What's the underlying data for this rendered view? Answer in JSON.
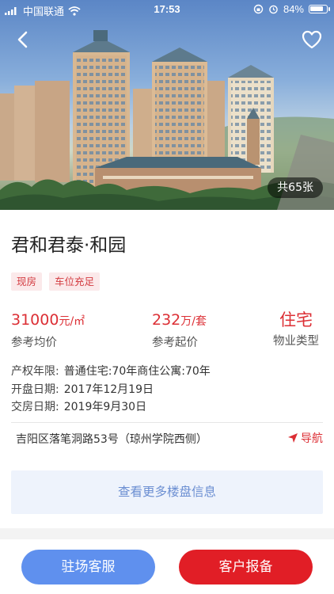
{
  "status_bar": {
    "carrier": "中国联通",
    "time": "17:53",
    "battery_text": "84%",
    "battery_level": 0.84
  },
  "hero": {
    "photo_count": "共65张"
  },
  "project": {
    "name": "君和君泰·和园",
    "tags": [
      "现房",
      "车位充足"
    ]
  },
  "stats": {
    "avg_price_value": "31000",
    "avg_price_unit": "元/㎡",
    "avg_price_label": "参考均价",
    "start_price_value": "232",
    "start_price_unit": "万/套",
    "start_price_label": "参考起价",
    "property_type_value": "住宅",
    "property_type_label": "物业类型"
  },
  "info": {
    "tenure_label": "产权年限:",
    "tenure_value": "普通住宅:70年商住公寓:70年",
    "opening_label": "开盘日期:",
    "opening_value": "2017年12月19日",
    "delivery_label": "交房日期:",
    "delivery_value": "2019年9月30日"
  },
  "address": {
    "text": "吉阳区落笔洞路53号（琼州学院西侧）",
    "nav_label": "导航"
  },
  "more_info_label": "查看更多楼盘信息",
  "bottom_bar": {
    "service_label": "驻场客服",
    "report_label": "客户报备"
  },
  "colors": {
    "accent_red": "#dc2f35",
    "tag_bg": "#fbe9ea",
    "service_blue": "#5f90ee",
    "report_red": "#e11e26",
    "more_bg": "#eef3fc",
    "more_text": "#6c8fd2"
  },
  "icons": {
    "back": "chevron-left-icon",
    "favorite": "heart-outline-icon",
    "navigate": "navigation-arrow-icon",
    "wifi": "wifi-icon",
    "signal": "signal-icon",
    "alarm": "alarm-icon",
    "lock": "orientation-lock-icon"
  }
}
